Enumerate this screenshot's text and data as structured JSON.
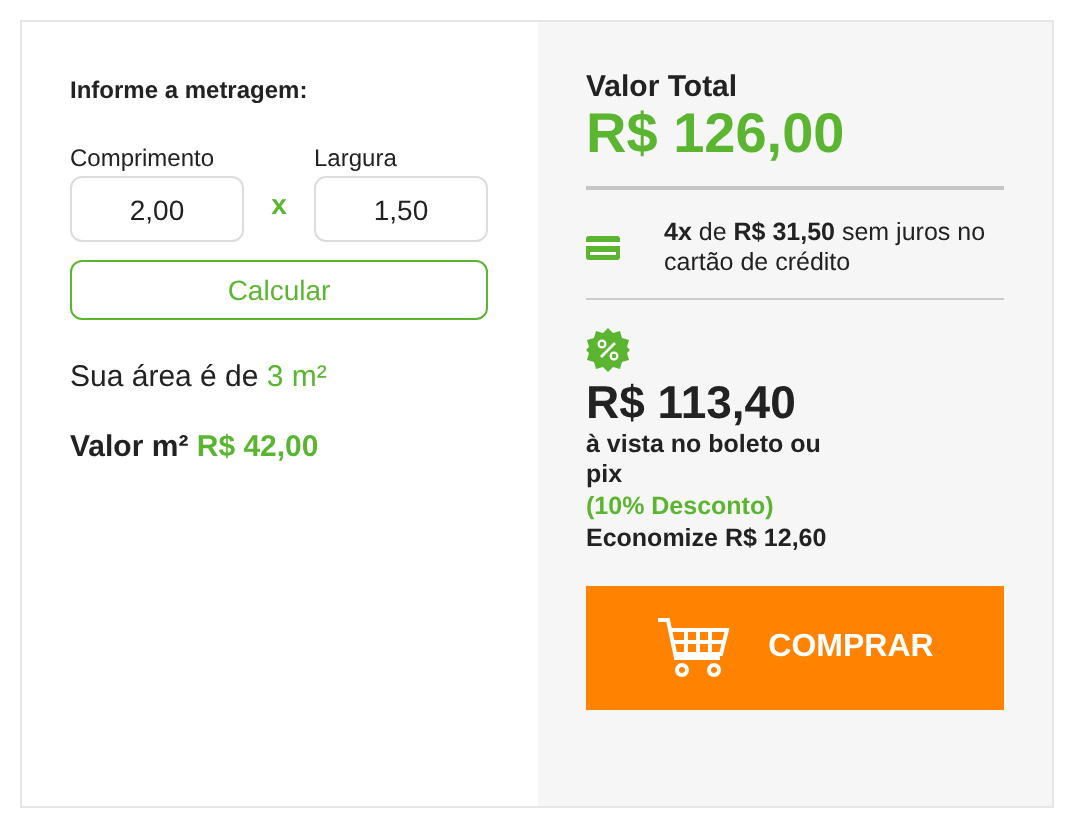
{
  "calculator": {
    "title": "Informe a metragem:",
    "fields": [
      {
        "label": "Comprimento",
        "value": "2,00"
      },
      {
        "label": "Largura",
        "value": "1,50"
      }
    ],
    "times_sign": "x",
    "button": "Calcular",
    "area_label": "Sua área é de",
    "area_value": "3 m²",
    "price_label": "Valor m²",
    "price_value": "R$ 42,00"
  },
  "summary": {
    "total_label": "Valor Total",
    "total_value": "R$ 126,00",
    "installments": "**4x** de **R$ 31,50** sem juros no cartão de crédito",
    "cash_price": "R$ 113,40",
    "cash_note": "à vista no boleto ou pix",
    "discount": "(10% Desconto)",
    "savings": "Economize R$ 12,60",
    "buy_button": "COMPRAR"
  }
}
